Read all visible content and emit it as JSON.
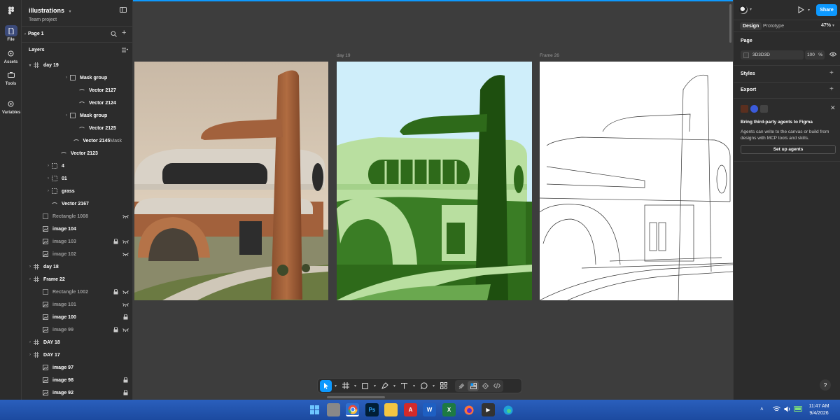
{
  "file": {
    "title": "illustrations",
    "subtitle": "Team project"
  },
  "rail": [
    {
      "label": "File",
      "icon": "file-icon"
    },
    {
      "label": "Assets",
      "icon": "assets-icon"
    },
    {
      "label": "Tools",
      "icon": "tools-icon"
    },
    {
      "label": "Variables",
      "icon": "variables-icon"
    }
  ],
  "page_name": "Page 1",
  "layers_title": "Layers",
  "layers": [
    {
      "name": "day 19",
      "indent": 0,
      "chev": "▾",
      "icon": "frame",
      "dim": false,
      "badge": "",
      "lock": false,
      "eye": false
    },
    {
      "name": "Mask group",
      "indent": 4,
      "chev": "›",
      "icon": "mask",
      "dim": false,
      "badge": "",
      "lock": false,
      "eye": false
    },
    {
      "name": "Vector 2127",
      "indent": 5,
      "chev": "",
      "icon": "vector",
      "dim": false,
      "badge": "",
      "lock": false,
      "eye": false
    },
    {
      "name": "Vector 2124",
      "indent": 5,
      "chev": "",
      "icon": "vector",
      "dim": false,
      "badge": "",
      "lock": false,
      "eye": false
    },
    {
      "name": "Mask group",
      "indent": 4,
      "chev": "›",
      "icon": "mask",
      "dim": false,
      "badge": "",
      "lock": false,
      "eye": false
    },
    {
      "name": "Vector 2125",
      "indent": 5,
      "chev": "",
      "icon": "vector",
      "dim": false,
      "badge": "",
      "lock": false,
      "eye": false
    },
    {
      "name": "Vector 2145",
      "indent": 5,
      "chev": "",
      "icon": "vector",
      "dim": false,
      "badge": "Mask",
      "lock": false,
      "eye": false
    },
    {
      "name": "Vector 2123",
      "indent": 3,
      "chev": "",
      "icon": "vector",
      "dim": false,
      "badge": "",
      "lock": false,
      "eye": false
    },
    {
      "name": "4",
      "indent": 2,
      "chev": "›",
      "icon": "group",
      "dim": false,
      "badge": "",
      "lock": false,
      "eye": false
    },
    {
      "name": "01",
      "indent": 2,
      "chev": "›",
      "icon": "group",
      "dim": false,
      "badge": "",
      "lock": false,
      "eye": false
    },
    {
      "name": "grass",
      "indent": 2,
      "chev": "›",
      "icon": "group",
      "dim": false,
      "badge": "",
      "lock": false,
      "eye": false
    },
    {
      "name": "Vector 2167",
      "indent": 2,
      "chev": "",
      "icon": "vector",
      "dim": false,
      "badge": "",
      "lock": false,
      "eye": false
    },
    {
      "name": "Rectangle 1008",
      "indent": 1,
      "chev": "",
      "icon": "rect",
      "dim": true,
      "badge": "",
      "lock": false,
      "eye": true
    },
    {
      "name": "image 104",
      "indent": 1,
      "chev": "",
      "icon": "image",
      "dim": false,
      "badge": "",
      "lock": false,
      "eye": false
    },
    {
      "name": "image 103",
      "indent": 1,
      "chev": "",
      "icon": "image",
      "dim": true,
      "badge": "",
      "lock": true,
      "eye": true
    },
    {
      "name": "image 102",
      "indent": 1,
      "chev": "",
      "icon": "image",
      "dim": true,
      "badge": "",
      "lock": false,
      "eye": true
    },
    {
      "name": "day 18",
      "indent": 0,
      "chev": "›",
      "icon": "frame",
      "dim": false,
      "badge": "",
      "lock": false,
      "eye": false
    },
    {
      "name": "Frame 22",
      "indent": 0,
      "chev": "›",
      "icon": "frame",
      "dim": false,
      "badge": "",
      "lock": false,
      "eye": false
    },
    {
      "name": "Rectangle 1002",
      "indent": 1,
      "chev": "",
      "icon": "rect",
      "dim": true,
      "badge": "",
      "lock": true,
      "eye": true
    },
    {
      "name": "image 101",
      "indent": 1,
      "chev": "",
      "icon": "image",
      "dim": true,
      "badge": "",
      "lock": false,
      "eye": true
    },
    {
      "name": "image 100",
      "indent": 1,
      "chev": "",
      "icon": "image",
      "dim": false,
      "badge": "",
      "lock": true,
      "eye": false
    },
    {
      "name": "image 99",
      "indent": 1,
      "chev": "",
      "icon": "image",
      "dim": true,
      "badge": "",
      "lock": true,
      "eye": true
    },
    {
      "name": "DAY 18",
      "indent": 0,
      "chev": "›",
      "icon": "frame",
      "dim": false,
      "badge": "",
      "lock": false,
      "eye": false
    },
    {
      "name": "DAY 17",
      "indent": 0,
      "chev": "›",
      "icon": "frame",
      "dim": false,
      "badge": "",
      "lock": false,
      "eye": false
    },
    {
      "name": "image 97",
      "indent": 1,
      "chev": "",
      "icon": "image",
      "dim": false,
      "badge": "",
      "lock": false,
      "eye": false
    },
    {
      "name": "image 98",
      "indent": 1,
      "chev": "",
      "icon": "image",
      "dim": false,
      "badge": "",
      "lock": true,
      "eye": false
    },
    {
      "name": "image 92",
      "indent": 1,
      "chev": "",
      "icon": "image",
      "dim": false,
      "badge": "",
      "lock": true,
      "eye": false
    }
  ],
  "canvas": {
    "frame_labels": {
      "f2": "day 19",
      "f3": "Frame 26"
    }
  },
  "right_panel": {
    "share": "Share",
    "tabs": {
      "design": "Design",
      "prototype": "Prototype"
    },
    "zoom": "47%",
    "page_section": "Page",
    "bg_color": "3D3D3D",
    "opacity": "100",
    "opacity_unit": "%",
    "styles": "Styles",
    "export": "Export",
    "agents_title": "Bring third-party agents to Figma",
    "agents_desc": "Agents can write to the canvas or build from designs with MCP tools and skills.",
    "agents_button": "Set up agents",
    "help": "?"
  },
  "taskbar": {
    "time": "11:47 AM",
    "date": "9/4/2026"
  },
  "colors": {
    "accent": "#0d99ff",
    "canvas_bg": "#3d3d3d",
    "panel_bg": "#2c2c2c"
  }
}
